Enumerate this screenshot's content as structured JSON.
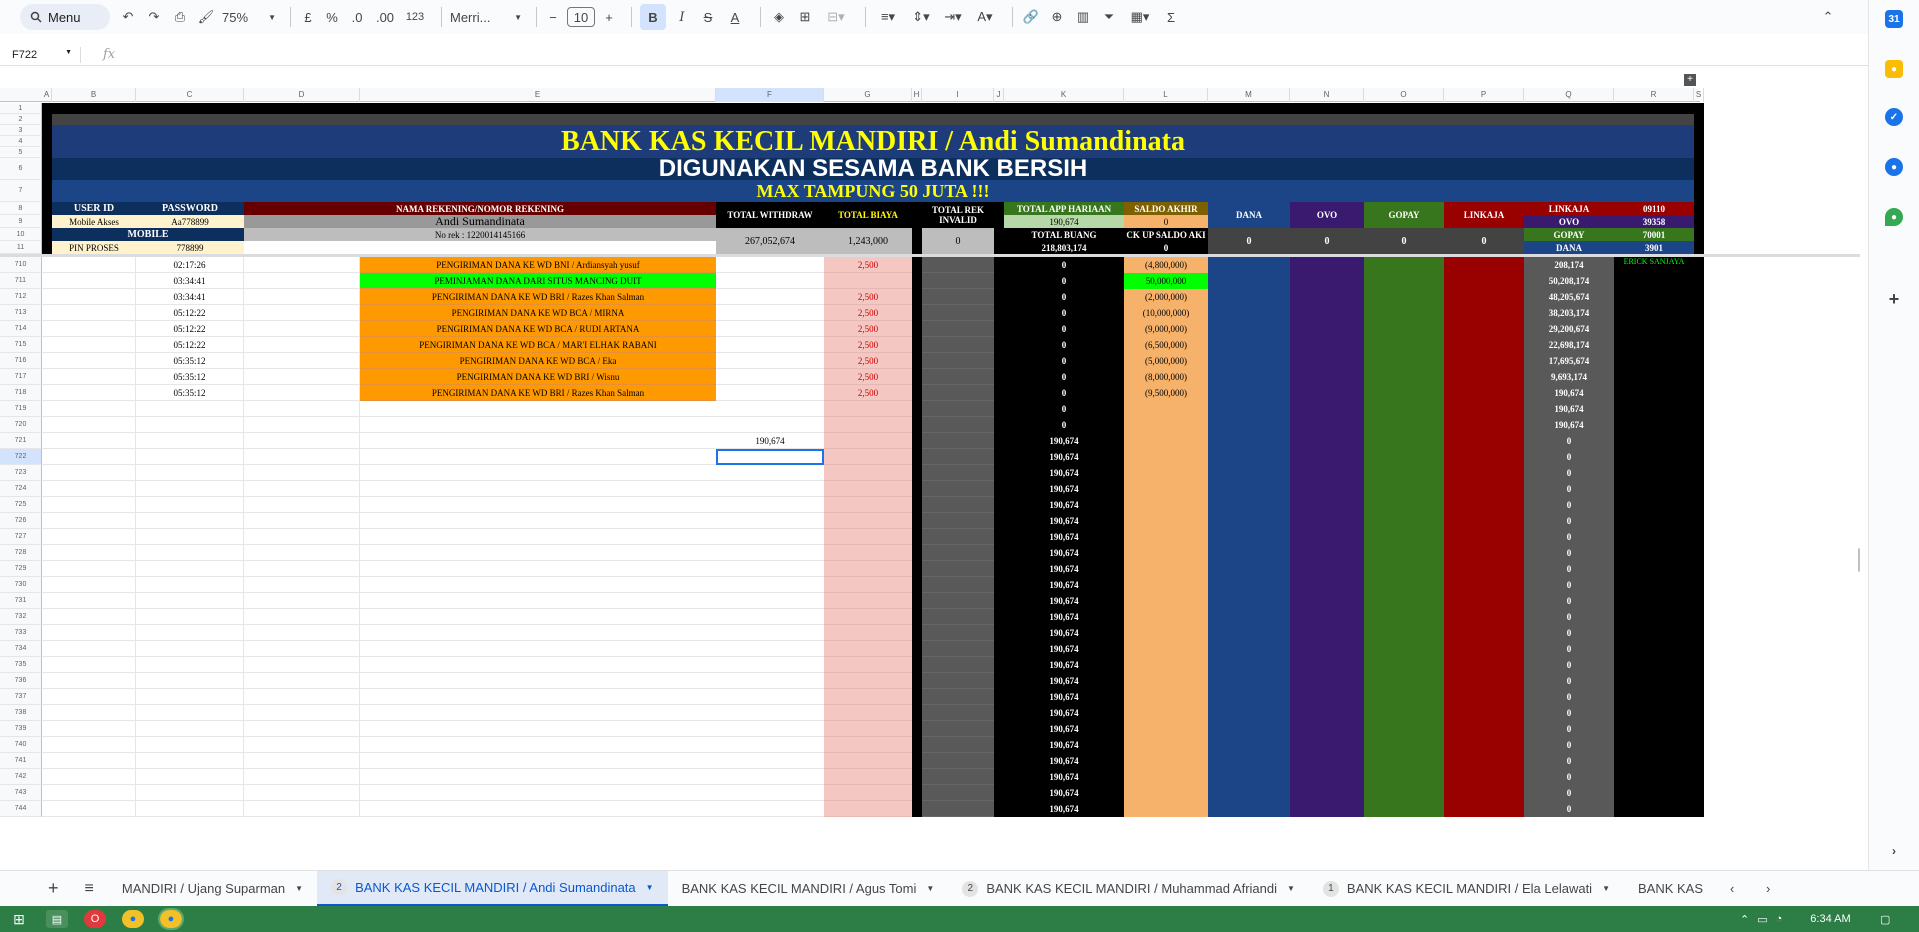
{
  "toolbar": {
    "menu_label": "Menu",
    "zoom": "75%",
    "currency": "£",
    "percent": "%",
    "dec_less": ".0",
    "dec_more": ".00",
    "format_123": "123",
    "font": "Merri...",
    "font_size": "10"
  },
  "formula_bar": {
    "cell_ref": "F722",
    "fx": "fx"
  },
  "columns": [
    "A",
    "B",
    "C",
    "D",
    "E",
    "F",
    "G",
    "H",
    "I",
    "J",
    "K",
    "L",
    "M",
    "N",
    "O",
    "P",
    "Q",
    "R",
    "S"
  ],
  "header": {
    "title": "BANK KAS KECIL MANDIRI / Andi Sumandinata",
    "subtitle": "DIGUNAKAN SESAMA BANK BERSIH",
    "max": "MAX TAMPUNG 50 JUTA !!!",
    "user_id": "USER ID",
    "password": "PASSWORD",
    "mobile_akses": "Mobile Akses",
    "pw_value": "Aa778899",
    "mobile": "MOBILE",
    "pin_proses": "PIN PROSES",
    "pin_value": "778899",
    "nama_rek": "NAMA REKENING/NOMOR REKENING",
    "account_name": "Andi Sumandinata",
    "no_rek": "No rek : 1220014145166",
    "total_withdraw": "TOTAL WITHDRAW",
    "total_withdraw_val": "267,052,674",
    "total_biaya": "TOTAL BIAYA",
    "total_biaya_val": "1,243,000",
    "total_rek_invalid": "TOTAL REK INVALID",
    "total_rek_invalid_val": "0",
    "total_app_harian": "TOTAL APP HARIAAN",
    "total_app_val": "190,674",
    "saldo_akhir": "SALDO AKHIR",
    "saldo_akhir_val": "0",
    "total_buang": "TOTAL BUANG",
    "total_buang_val": "218,803,174",
    "backup_saldo": "CK UP SALDO AKI",
    "backup_val": "0",
    "dana": "DANA",
    "ovo": "OVO",
    "gopay": "GOPAY",
    "linkaja": "LINKAJA",
    "dana_val": "0",
    "ovo_val": "0",
    "gopay_val": "0",
    "linkaja_val": "0",
    "side": [
      {
        "label": "LINKAJA",
        "val": "09110"
      },
      {
        "label": "OVO",
        "val": "39358"
      },
      {
        "label": "GOPAY",
        "val": "70001"
      },
      {
        "label": "DANA",
        "val": "3901"
      }
    ]
  },
  "header_rows": [
    "1",
    "2",
    "3",
    "4",
    "5",
    "6",
    "7",
    "8",
    "9",
    "10",
    "11"
  ],
  "rows": [
    {
      "n": "710",
      "time": "02:17:26",
      "desc": "PENGIRIMAN DANA KE WD BNI / Ardiansyah yusuf",
      "g": "2,500",
      "k": "0",
      "l": "(4,800,000)",
      "q": "208,174",
      "r": "ERICK SANJAYA",
      "hl": false
    },
    {
      "n": "711",
      "time": "03:34:41",
      "desc": "PEMINJAMAN DANA DARI SITUS MANCING DUIT",
      "g": "",
      "k": "0",
      "l": "50,000,000",
      "q": "50,208,174",
      "r": "",
      "hl": true
    },
    {
      "n": "712",
      "time": "03:34:41",
      "desc": "PENGIRIMAN DANA KE WD BRI / Razes Khan Salman",
      "g": "2,500",
      "k": "0",
      "l": "(2,000,000)",
      "q": "48,205,674",
      "r": "",
      "hl": false
    },
    {
      "n": "713",
      "time": "05:12:22",
      "desc": "PENGIRIMAN DANA KE WD BCA / MIRNA",
      "g": "2,500",
      "k": "0",
      "l": "(10,000,000)",
      "q": "38,203,174",
      "r": "",
      "hl": false
    },
    {
      "n": "714",
      "time": "05:12:22",
      "desc": "PENGIRIMAN DANA KE WD BCA / RUDI ARTANA",
      "g": "2,500",
      "k": "0",
      "l": "(9,000,000)",
      "q": "29,200,674",
      "r": "",
      "hl": false
    },
    {
      "n": "715",
      "time": "05:12:22",
      "desc": "PENGIRIMAN DANA KE WD BCA / MAR'I ELHAK RABANI",
      "g": "2,500",
      "k": "0",
      "l": "(6,500,000)",
      "q": "22,698,174",
      "r": "",
      "hl": false
    },
    {
      "n": "716",
      "time": "05:35:12",
      "desc": "PENGIRIMAN DANA KE WD BCA / Eka",
      "g": "2,500",
      "k": "0",
      "l": "(5,000,000)",
      "q": "17,695,674",
      "r": "",
      "hl": false
    },
    {
      "n": "717",
      "time": "05:35:12",
      "desc": "PENGIRIMAN DANA KE WD BRI / Wisnu",
      "g": "2,500",
      "k": "0",
      "l": "(8,000,000)",
      "q": "9,693,174",
      "r": "",
      "hl": false
    },
    {
      "n": "718",
      "time": "05:35:12",
      "desc": "PENGIRIMAN DANA KE WD BRI / Razes Khan Salman",
      "g": "2,500",
      "k": "0",
      "l": "(9,500,000)",
      "q": "190,674",
      "r": "",
      "hl": false
    },
    {
      "n": "719",
      "time": "",
      "desc": "",
      "g": "",
      "k": "0",
      "l": "",
      "q": "190,674",
      "r": "",
      "hl": false
    },
    {
      "n": "720",
      "time": "",
      "desc": "",
      "g": "",
      "k": "0",
      "l": "",
      "q": "190,674",
      "r": "",
      "hl": false
    },
    {
      "n": "721",
      "time": "",
      "desc": "",
      "g": "",
      "k": "190,674",
      "l": "",
      "q": "0",
      "r": "",
      "hl": false,
      "f": "190,674"
    },
    {
      "n": "722",
      "time": "",
      "desc": "",
      "g": "",
      "k": "190,674",
      "l": "",
      "q": "0",
      "r": "",
      "hl": false
    },
    {
      "n": "723",
      "time": "",
      "desc": "",
      "g": "",
      "k": "190,674",
      "l": "",
      "q": "0",
      "r": "",
      "hl": false
    },
    {
      "n": "724",
      "time": "",
      "desc": "",
      "g": "",
      "k": "190,674",
      "l": "",
      "q": "0",
      "r": "",
      "hl": false
    },
    {
      "n": "725",
      "time": "",
      "desc": "",
      "g": "",
      "k": "190,674",
      "l": "",
      "q": "0",
      "r": "",
      "hl": false
    },
    {
      "n": "726",
      "time": "",
      "desc": "",
      "g": "",
      "k": "190,674",
      "l": "",
      "q": "0",
      "r": "",
      "hl": false
    },
    {
      "n": "727",
      "time": "",
      "desc": "",
      "g": "",
      "k": "190,674",
      "l": "",
      "q": "0",
      "r": "",
      "hl": false
    },
    {
      "n": "728",
      "time": "",
      "desc": "",
      "g": "",
      "k": "190,674",
      "l": "",
      "q": "0",
      "r": "",
      "hl": false
    },
    {
      "n": "729",
      "time": "",
      "desc": "",
      "g": "",
      "k": "190,674",
      "l": "",
      "q": "0",
      "r": "",
      "hl": false
    },
    {
      "n": "730",
      "time": "",
      "desc": "",
      "g": "",
      "k": "190,674",
      "l": "",
      "q": "0",
      "r": "",
      "hl": false
    },
    {
      "n": "731",
      "time": "",
      "desc": "",
      "g": "",
      "k": "190,674",
      "l": "",
      "q": "0",
      "r": "",
      "hl": false
    },
    {
      "n": "732",
      "time": "",
      "desc": "",
      "g": "",
      "k": "190,674",
      "l": "",
      "q": "0",
      "r": "",
      "hl": false
    },
    {
      "n": "733",
      "time": "",
      "desc": "",
      "g": "",
      "k": "190,674",
      "l": "",
      "q": "0",
      "r": "",
      "hl": false
    },
    {
      "n": "734",
      "time": "",
      "desc": "",
      "g": "",
      "k": "190,674",
      "l": "",
      "q": "0",
      "r": "",
      "hl": false
    },
    {
      "n": "735",
      "time": "",
      "desc": "",
      "g": "",
      "k": "190,674",
      "l": "",
      "q": "0",
      "r": "",
      "hl": false
    },
    {
      "n": "736",
      "time": "",
      "desc": "",
      "g": "",
      "k": "190,674",
      "l": "",
      "q": "0",
      "r": "",
      "hl": false
    },
    {
      "n": "737",
      "time": "",
      "desc": "",
      "g": "",
      "k": "190,674",
      "l": "",
      "q": "0",
      "r": "",
      "hl": false
    },
    {
      "n": "738",
      "time": "",
      "desc": "",
      "g": "",
      "k": "190,674",
      "l": "",
      "q": "0",
      "r": "",
      "hl": false
    },
    {
      "n": "739",
      "time": "",
      "desc": "",
      "g": "",
      "k": "190,674",
      "l": "",
      "q": "0",
      "r": "",
      "hl": false
    },
    {
      "n": "740",
      "time": "",
      "desc": "",
      "g": "",
      "k": "190,674",
      "l": "",
      "q": "0",
      "r": "",
      "hl": false
    },
    {
      "n": "741",
      "time": "",
      "desc": "",
      "g": "",
      "k": "190,674",
      "l": "",
      "q": "0",
      "r": "",
      "hl": false
    },
    {
      "n": "742",
      "time": "",
      "desc": "",
      "g": "",
      "k": "190,674",
      "l": "",
      "q": "0",
      "r": "",
      "hl": false
    },
    {
      "n": "743",
      "time": "",
      "desc": "",
      "g": "",
      "k": "190,674",
      "l": "",
      "q": "0",
      "r": "",
      "hl": false
    },
    {
      "n": "744",
      "time": "",
      "desc": "",
      "g": "",
      "k": "190,674",
      "l": "",
      "q": "0",
      "r": "",
      "hl": false
    }
  ],
  "tabs": [
    {
      "label": "MANDIRI / Ujang Suparman",
      "badge": "",
      "active": false
    },
    {
      "label": "BANK KAS KECIL MANDIRI / Andi Sumandinata",
      "badge": "2",
      "active": true
    },
    {
      "label": "BANK KAS KECIL MANDIRI / Agus Tomi",
      "badge": "",
      "active": false
    },
    {
      "label": "BANK KAS KECIL MANDIRI / Muhammad Afriandi",
      "badge": "2",
      "active": false
    },
    {
      "label": "BANK KAS KECIL MANDIRI / Ela Lelawati",
      "badge": "1",
      "active": false
    },
    {
      "label": "BANK KAS",
      "badge": "",
      "active": false
    }
  ],
  "taskbar": {
    "time": "6:34 AM"
  },
  "colors": {
    "navy": "#1f3c7a",
    "darknavy": "#0c2f5e",
    "yellow": "#ffff00",
    "orange": "#ff9900",
    "pink": "#f4c7c3",
    "peach": "#f6b26b",
    "grey": "#595959",
    "purple": "#3a1a6e",
    "green": "#38761d",
    "red": "#990000",
    "blue": "#1c4587"
  }
}
